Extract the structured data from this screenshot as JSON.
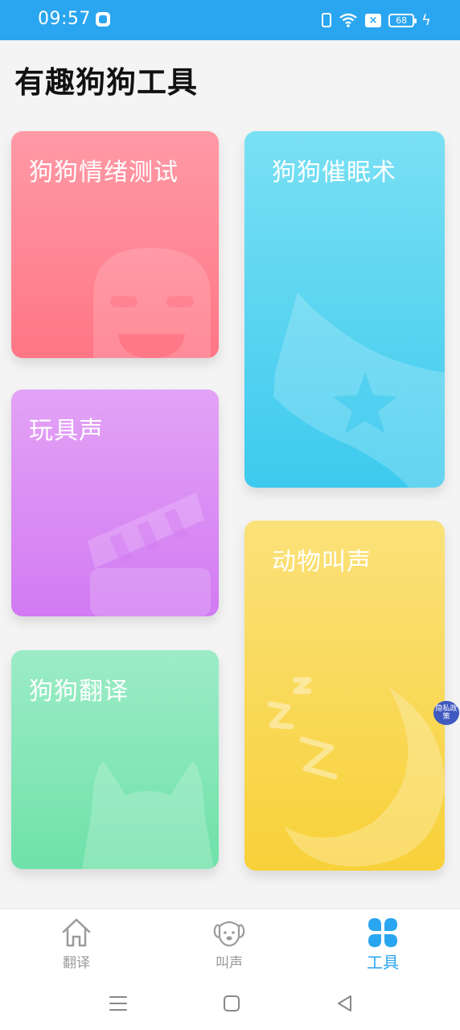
{
  "status_bar": {
    "time": "09:57",
    "battery": "68",
    "icons": [
      "app-notification-icon",
      "vibrate-icon",
      "wifi-icon",
      "sim-disabled-icon",
      "battery-icon",
      "charging-icon"
    ]
  },
  "header": {
    "title": "有趣狗狗工具"
  },
  "cards": {
    "emotion_test": {
      "title": "狗狗情绪测试",
      "icon": "smiling-face-icon"
    },
    "hypnosis": {
      "title": "狗狗催眠术",
      "icon": "flag-star-icon"
    },
    "toy_sound": {
      "title": "玩具声",
      "icon": "clapperboard-icon"
    },
    "animal_sounds": {
      "title": "动物叫声",
      "icon": "moon-sleep-icon"
    },
    "dog_translate": {
      "title": "狗狗翻译",
      "icon": "cat-head-icon"
    }
  },
  "privacy_badge": {
    "label": "隐私政策"
  },
  "tab_bar": {
    "tabs": [
      {
        "label": "翻译",
        "icon": "home-icon",
        "active": false
      },
      {
        "label": "叫声",
        "icon": "dog-face-icon",
        "active": false
      },
      {
        "label": "工具",
        "icon": "four-leaf-grid-icon",
        "active": true
      }
    ]
  },
  "nav_bar": {
    "buttons": [
      "menu-icon",
      "home-square-icon",
      "back-triangle-icon"
    ]
  },
  "colors": {
    "status_bar": "#2aa6f0",
    "accent": "#2aa6f0",
    "emotion_card": "#ff8595",
    "hypnosis_card": "#52d3f1",
    "toy_card": "#dc8ff5",
    "animal_card": "#f9d85a",
    "translate_card": "#85e6b8",
    "privacy_badge": "#3f59bf"
  }
}
